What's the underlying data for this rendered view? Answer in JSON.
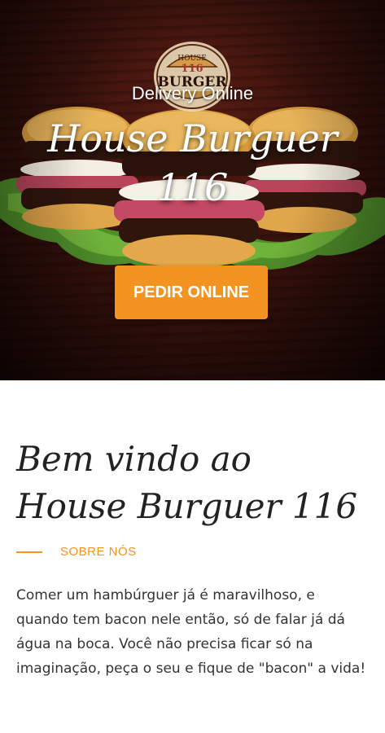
{
  "hero": {
    "logo": {
      "top_text": "HOUSE",
      "number": "116",
      "word": "BURGER",
      "icon": "burger-logo-badge"
    },
    "subtitle": "Delivery Online",
    "title": "House Burguer 116",
    "order_button_label": "PEDIR ONLINE",
    "background_image": "stacked-bacon-burgers-on-wood"
  },
  "about": {
    "heading": "Bem vindo ao House Burguer 116",
    "kicker": "SOBRE NÓS",
    "body": "Comer um hambúrguer já é maravilhoso, e quando tem bacon nele então, só de falar já dá água na boca. Você não precisa ficar só na imaginação, peça o seu e fique de \"bacon\" a vida!"
  },
  "colors": {
    "accent": "#f39321",
    "heading_text": "#222222",
    "body_text": "#333333",
    "hero_bg": "#3a120c"
  }
}
